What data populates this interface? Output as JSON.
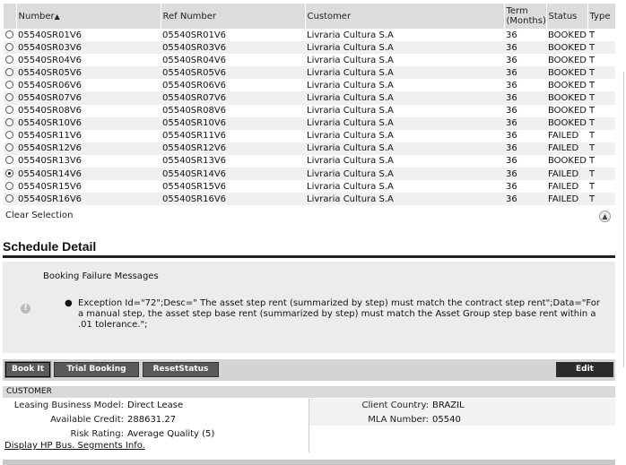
{
  "columns": {
    "number": "Number",
    "ref_number": "Ref Number",
    "customer": "Customer",
    "term": "Term (Months)",
    "status": "Status",
    "type": "Type"
  },
  "rows": [
    {
      "number": "05540SR01V6",
      "ref": "05540SR01V6",
      "customer": "Livraria Cultura S.A",
      "term": "36",
      "status": "BOOKED",
      "type": "T",
      "selected": false
    },
    {
      "number": "05540SR03V6",
      "ref": "05540SR03V6",
      "customer": "Livraria Cultura S.A",
      "term": "36",
      "status": "BOOKED",
      "type": "T",
      "selected": false
    },
    {
      "number": "05540SR04V6",
      "ref": "05540SR04V6",
      "customer": "Livraria Cultura S.A",
      "term": "36",
      "status": "BOOKED",
      "type": "T",
      "selected": false
    },
    {
      "number": "05540SR05V6",
      "ref": "05540SR05V6",
      "customer": "Livraria Cultura S.A",
      "term": "36",
      "status": "BOOKED",
      "type": "T",
      "selected": false
    },
    {
      "number": "05540SR06V6",
      "ref": "05540SR06V6",
      "customer": "Livraria Cultura S.A",
      "term": "36",
      "status": "BOOKED",
      "type": "T",
      "selected": false
    },
    {
      "number": "05540SR07V6",
      "ref": "05540SR07V6",
      "customer": "Livraria Cultura S.A",
      "term": "36",
      "status": "BOOKED",
      "type": "T",
      "selected": false
    },
    {
      "number": "05540SR08V6",
      "ref": "05540SR08V6",
      "customer": "Livraria Cultura S.A",
      "term": "36",
      "status": "BOOKED",
      "type": "T",
      "selected": false
    },
    {
      "number": "05540SR10V6",
      "ref": "05540SR10V6",
      "customer": "Livraria Cultura S.A",
      "term": "36",
      "status": "BOOKED",
      "type": "T",
      "selected": false
    },
    {
      "number": "05540SR11V6",
      "ref": "05540SR11V6",
      "customer": "Livraria Cultura S.A",
      "term": "36",
      "status": "FAILED",
      "type": "T",
      "selected": false
    },
    {
      "number": "05540SR12V6",
      "ref": "05540SR12V6",
      "customer": "Livraria Cultura S.A",
      "term": "36",
      "status": "FAILED",
      "type": "T",
      "selected": false
    },
    {
      "number": "05540SR13V6",
      "ref": "05540SR13V6",
      "customer": "Livraria Cultura S.A",
      "term": "36",
      "status": "BOOKED",
      "type": "T",
      "selected": false
    },
    {
      "number": "05540SR14V6",
      "ref": "05540SR14V6",
      "customer": "Livraria Cultura S.A",
      "term": "36",
      "status": "FAILED",
      "type": "T",
      "selected": true
    },
    {
      "number": "05540SR15V6",
      "ref": "05540SR15V6",
      "customer": "Livraria Cultura S.A",
      "term": "36",
      "status": "FAILED",
      "type": "T",
      "selected": false
    },
    {
      "number": "05540SR16V6",
      "ref": "05540SR16V6",
      "customer": "Livraria Cultura S.A",
      "term": "36",
      "status": "FAILED",
      "type": "T",
      "selected": false
    }
  ],
  "clear_selection": "Clear Selection",
  "section_title": "Schedule Detail",
  "messages": {
    "header": "Booking Failure Messages",
    "text": "Exception Id=\"72\";Desc=\" The asset step rent (summarized by step) must match the contract step rent\";Data=\"For a manual step, the asset step base rent (summarized by step) must match the Asset Group step base rent within a .01 tolerance.\";"
  },
  "buttons": {
    "book_it": "Book It",
    "trial_booking": "Trial Booking",
    "reset_status": "ResetStatus",
    "edit": "Edit"
  },
  "customer": {
    "header": "CUSTOMER",
    "leasing_model_label": "Leasing Business Model:",
    "leasing_model": "Direct Lease",
    "available_credit_label": "Available Credit:",
    "available_credit": "288631.27",
    "risk_rating_label": "Risk Rating:",
    "risk_rating": "Average Quality (5)",
    "client_country_label": "Client Country:",
    "client_country": "BRAZIL",
    "mla_number_label": "MLA Number:",
    "mla_number": "05540",
    "hp_link": "Display HP Bus. Segments Info."
  },
  "colors": {
    "header_bg": "#dcdcdc",
    "button_bg": "#5a5a5a",
    "edit_bg": "#2b2b2b"
  }
}
